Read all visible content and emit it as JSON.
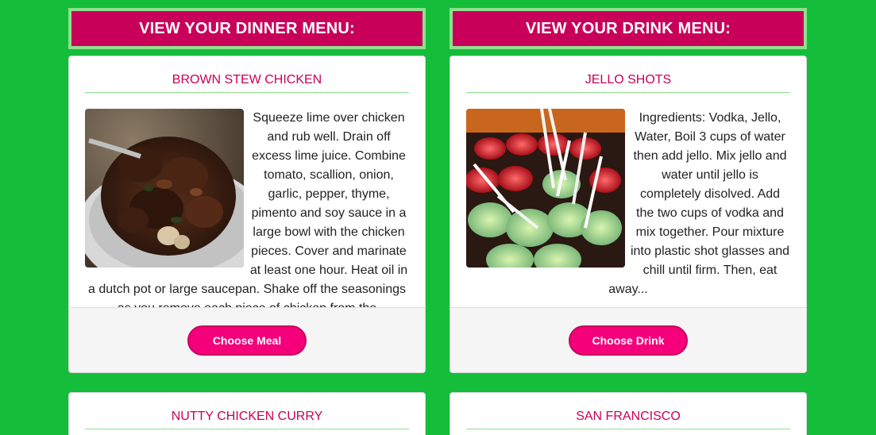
{
  "colors": {
    "page_background": "#14bd3a",
    "header_background": "#c8005a",
    "header_border": "#8ee08e",
    "title_color": "#c8005a",
    "button_color": "#f5007a"
  },
  "dinner": {
    "header": "VIEW YOUR DINNER MENU:",
    "card": {
      "title": "BROWN STEW CHICKEN",
      "image_icon": "brown-stew-chicken-photo",
      "description": "Squeeze lime over chicken and rub well. Drain off excess lime juice. Combine tomato, scallion, onion, garlic, pepper, thyme, pimento and soy sauce in a large bowl with the chicken pieces. Cover and marinate at least one hour. Heat oil in a dutch pot or large saucepan. Shake off the seasonings as you remove each piece of chicken from the",
      "button": "Choose Meal"
    },
    "next_card_title": "NUTTY CHICKEN CURRY"
  },
  "drink": {
    "header": "VIEW YOUR DRINK MENU:",
    "card": {
      "title": "JELLO SHOTS",
      "image_icon": "jello-shots-photo",
      "description": "Ingredients: Vodka, Jello, Water, Boil 3 cups of water then add jello. Mix jello and water until jello is completely disolved. Add the two cups of vodka and mix together. Pour mixture into plastic shot glasses and chill until firm. Then, eat away...",
      "button": "Choose Drink"
    },
    "next_card_title": "SAN FRANCISCO"
  }
}
